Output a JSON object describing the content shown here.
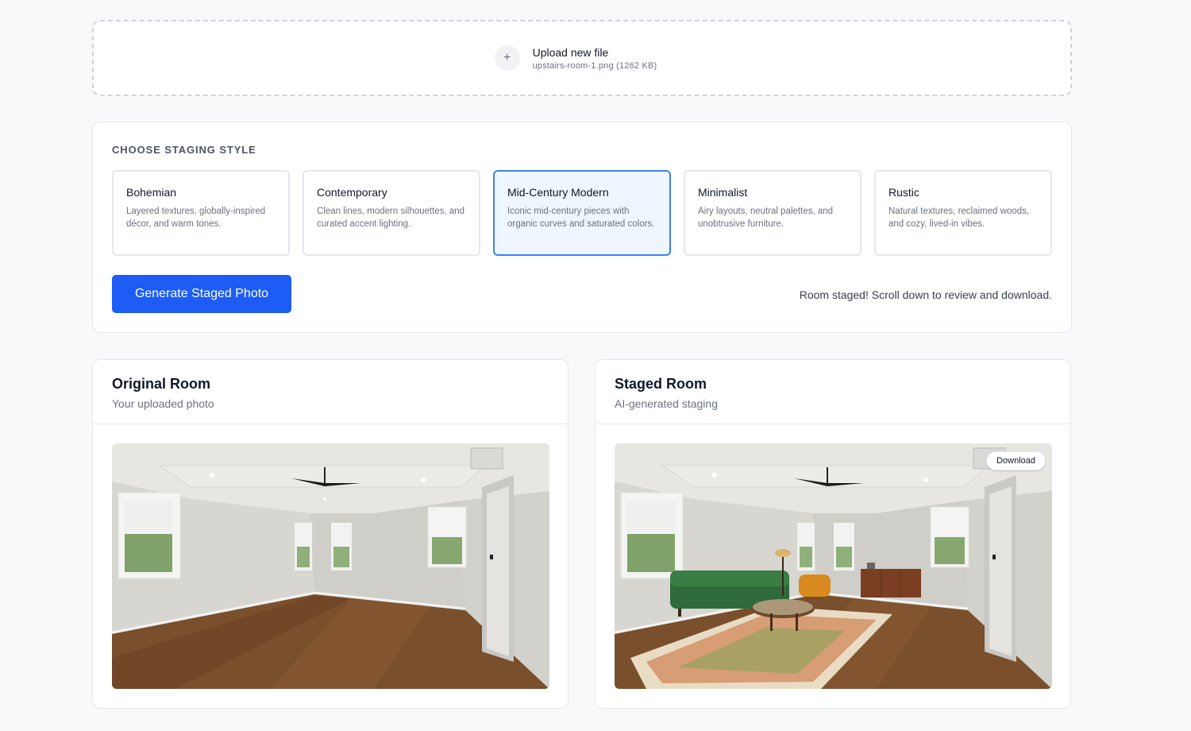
{
  "upload": {
    "icon": "plus-icon",
    "title": "Upload new file",
    "file_info": "upstairs-room-1.png (1262 KB)"
  },
  "staging": {
    "section_label": "CHOOSE STAGING STYLE",
    "selected": "Mid-Century Modern",
    "styles": [
      {
        "name": "Bohemian",
        "description": "Layered textures, globally-inspired décor, and warm tones."
      },
      {
        "name": "Contemporary",
        "description": "Clean lines, modern silhouettes, and curated accent lighting."
      },
      {
        "name": "Mid-Century Modern",
        "description": "Iconic mid-century pieces with organic curves and saturated colors."
      },
      {
        "name": "Minimalist",
        "description": "Airy layouts, neutral palettes, and unobtrusive furniture."
      },
      {
        "name": "Rustic",
        "description": "Natural textures, reclaimed woods, and cozy, lived-in vibes."
      }
    ],
    "generate_label": "Generate Staged Photo",
    "status": "Room staged! Scroll down to review and download."
  },
  "original": {
    "title": "Original Room",
    "subtitle": "Your uploaded photo"
  },
  "staged": {
    "title": "Staged Room",
    "subtitle": "AI-generated staging",
    "download_label": "Download"
  },
  "colors": {
    "primary": "#1d5cf5",
    "selected_border": "#3b82f6",
    "selected_bg": "#eff6ff"
  }
}
